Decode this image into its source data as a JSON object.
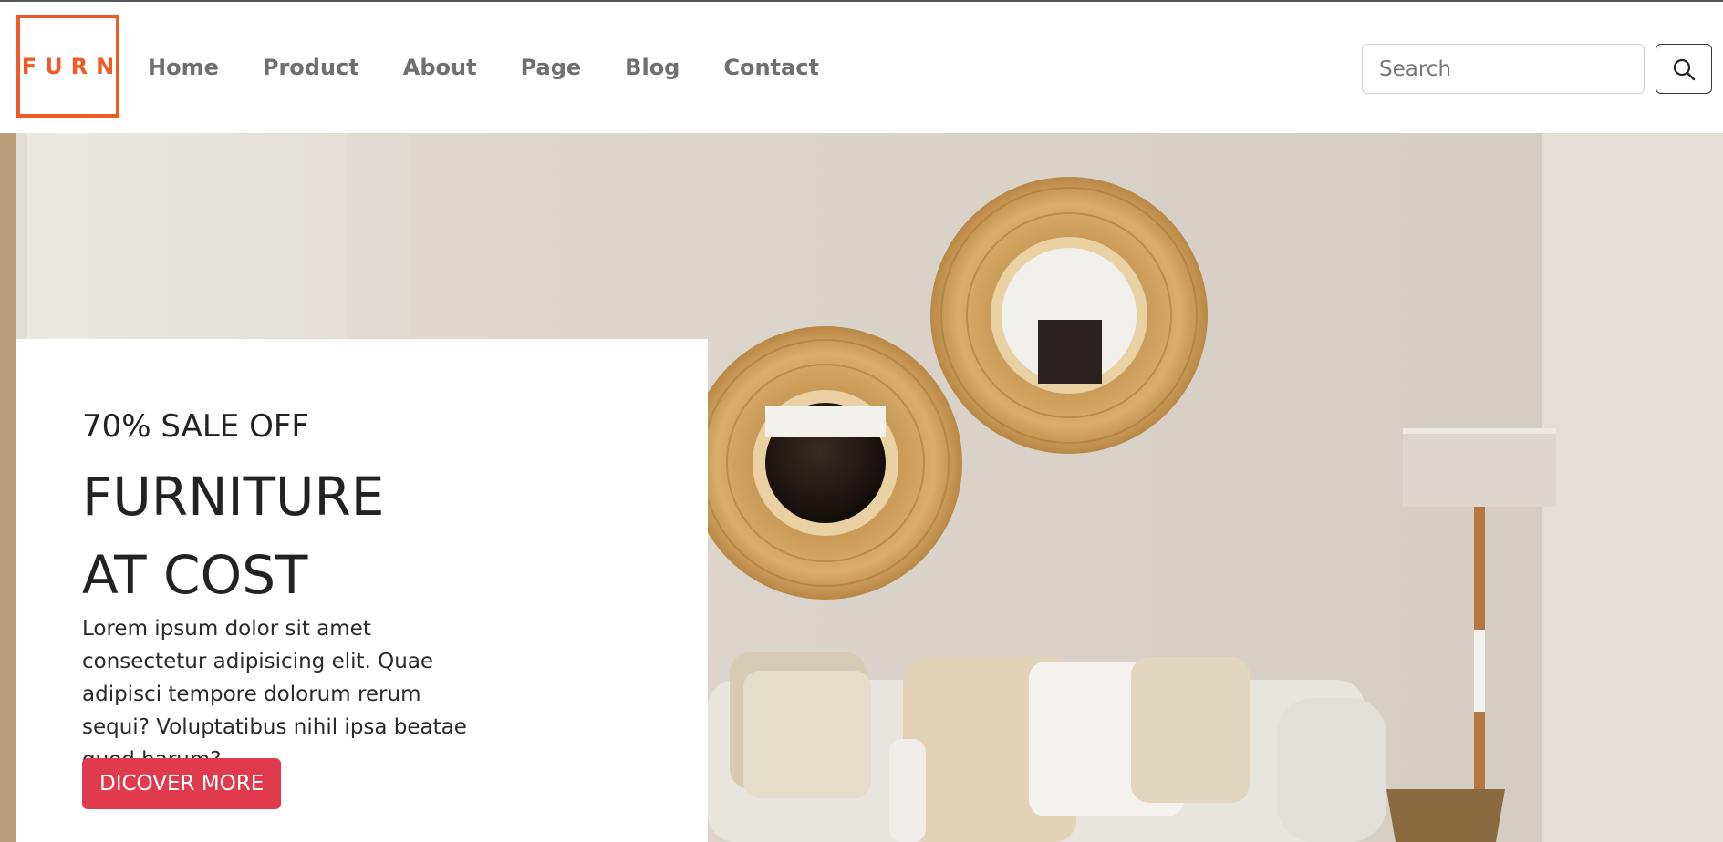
{
  "brand": {
    "logo_text": "FURN",
    "accent_color": "#f15a24"
  },
  "nav": {
    "items": [
      {
        "label": "Home"
      },
      {
        "label": "Product"
      },
      {
        "label": "About"
      },
      {
        "label": "Page"
      },
      {
        "label": "Blog"
      },
      {
        "label": "Contact"
      }
    ]
  },
  "search": {
    "placeholder": "Search",
    "value": "",
    "icon": "search-icon"
  },
  "hero": {
    "eyebrow": "70% SALE OFF",
    "title_line1": "FURNITURE",
    "title_line2": "AT COST",
    "description": "Lorem ipsum dolor sit amet consectetur adipisicing elit. Quae adipisci tempore dolorum rerum sequi? Voluptatibus nihil ipsa beatae quod harum?",
    "cta_label": "DICOVER MORE",
    "cta_color": "#e03a4e",
    "background_image": "living-room-with-rattan-mirrors-sofa-and-floor-lamp"
  }
}
